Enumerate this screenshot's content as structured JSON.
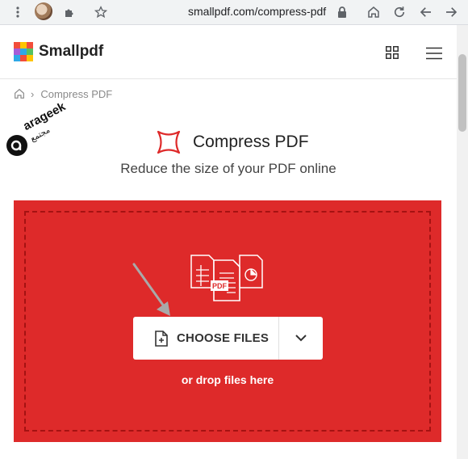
{
  "browser": {
    "url": "smallpdf.com/compress-pdf"
  },
  "header": {
    "logo_text": "Smallpdf",
    "brand_colors": [
      "#f24e3a",
      "#ffc400",
      "#2ea8e6",
      "#56c15f",
      "#a45cd8"
    ]
  },
  "breadcrumb": {
    "current": "Compress PDF"
  },
  "watermark": {
    "text": "arageek",
    "sub": "مجتمع"
  },
  "main": {
    "title": "Compress PDF",
    "subtitle": "Reduce the size of your PDF online",
    "accent_color": "#de2a2a",
    "illustration_label": "PDF",
    "choose_button": "CHOOSE FILES",
    "drop_hint": "or drop files here"
  }
}
